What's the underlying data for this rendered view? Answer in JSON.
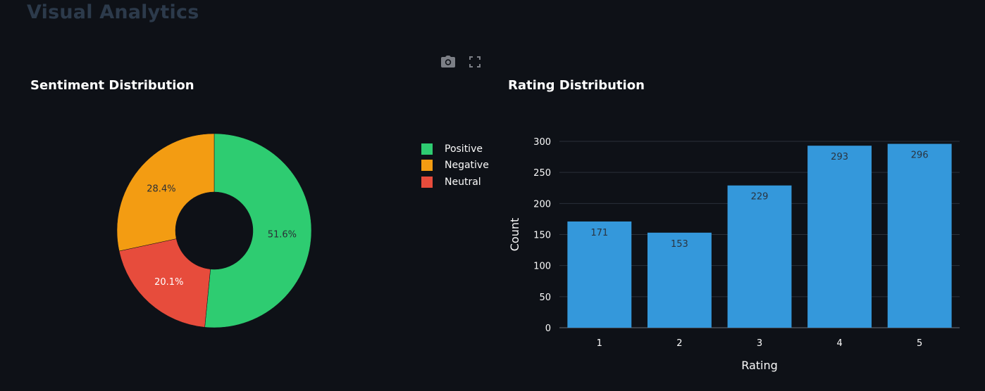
{
  "page": {
    "title": "Visual Analytics"
  },
  "toolbar": {
    "camera_icon": "camera-icon",
    "fullscreen_icon": "fullscreen-icon"
  },
  "colors": {
    "background": "#0e1117",
    "positive": "#2ecc71",
    "negative": "#f39c12",
    "neutral": "#e74c3c",
    "bar": "#3498db",
    "grid": "#2a303a",
    "tick": "#fafafa"
  },
  "chart_data": [
    {
      "type": "pie",
      "title": "Sentiment Distribution",
      "hole": true,
      "labels": [
        "Positive",
        "Negative",
        "Neutral"
      ],
      "values": [
        51.6,
        28.4,
        20.1
      ],
      "value_labels": [
        "51.6%",
        "28.4%",
        "20.1%"
      ],
      "legend": "right"
    },
    {
      "type": "bar",
      "title": "Rating Distribution",
      "xlabel": "Rating",
      "ylabel": "Count",
      "categories": [
        "1",
        "2",
        "3",
        "4",
        "5"
      ],
      "values": [
        171,
        153,
        229,
        293,
        296
      ],
      "ylim": [
        0,
        300
      ],
      "yticks": [
        "0",
        "50",
        "100",
        "150",
        "200",
        "250",
        "300"
      ],
      "grid": true
    }
  ]
}
